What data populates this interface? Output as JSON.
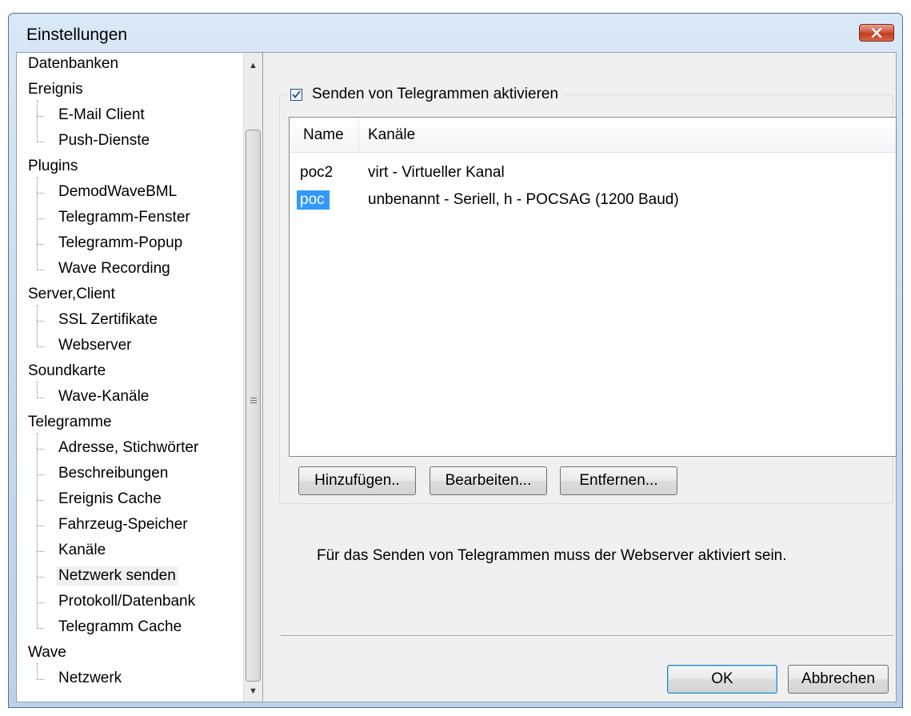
{
  "window": {
    "title": "Einstellungen"
  },
  "tree": {
    "items": [
      {
        "label": "Datenbanken",
        "level": 0
      },
      {
        "label": "Ereignis",
        "level": 0
      },
      {
        "label": "E-Mail Client",
        "level": 1
      },
      {
        "label": "Push-Dienste",
        "level": 1
      },
      {
        "label": "Plugins",
        "level": 0
      },
      {
        "label": "DemodWaveBML",
        "level": 1
      },
      {
        "label": "Telegramm-Fenster",
        "level": 1
      },
      {
        "label": "Telegramm-Popup",
        "level": 1
      },
      {
        "label": "Wave Recording",
        "level": 1
      },
      {
        "label": "Server,Client",
        "level": 0
      },
      {
        "label": "SSL Zertifikate",
        "level": 1
      },
      {
        "label": "Webserver",
        "level": 1
      },
      {
        "label": "Soundkarte",
        "level": 0
      },
      {
        "label": "Wave-Kanäle",
        "level": 1
      },
      {
        "label": "Telegramme",
        "level": 0
      },
      {
        "label": "Adresse, Stichwörter",
        "level": 1
      },
      {
        "label": "Beschreibungen",
        "level": 1
      },
      {
        "label": "Ereignis Cache",
        "level": 1
      },
      {
        "label": "Fahrzeug-Speicher",
        "level": 1
      },
      {
        "label": "Kanäle",
        "level": 1
      },
      {
        "label": "Netzwerk senden",
        "level": 1,
        "selected": true
      },
      {
        "label": "Protokoll/Datenbank",
        "level": 1
      },
      {
        "label": "Telegramm Cache",
        "level": 1
      },
      {
        "label": "Wave",
        "level": 0
      },
      {
        "label": "Netzwerk",
        "level": 1
      }
    ]
  },
  "panel": {
    "enable_sending_label": "Senden von Telegrammen aktivieren",
    "enable_sending_checked": true,
    "columns": [
      "Name",
      "Kanäle"
    ],
    "rows": [
      {
        "name": "poc2",
        "channels": "virt - Virtueller Kanal",
        "selected": false
      },
      {
        "name": "poc",
        "channels": "unbenannt - Seriell, h - POCSAG (1200 Baud)",
        "selected": true
      }
    ],
    "buttons": {
      "add": "Hinzufügen..",
      "edit": "Bearbeiten...",
      "remove": "Entfernen..."
    },
    "info_text": "Für das Senden von Telegrammen muss der Webserver aktiviert sein."
  },
  "footer": {
    "ok": "OK",
    "cancel": "Abbrechen"
  }
}
